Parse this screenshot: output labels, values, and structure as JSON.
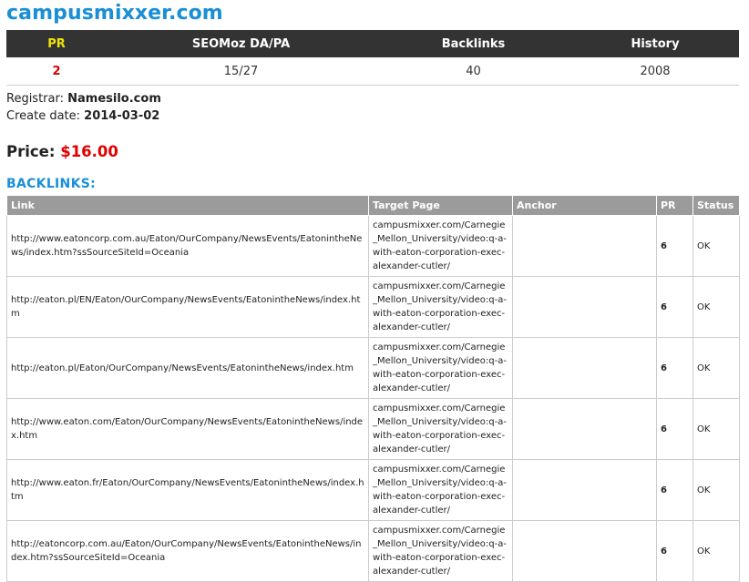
{
  "site": {
    "title": "campusmixxer.com"
  },
  "stats": {
    "headers": [
      "PR",
      "SEOMoz DA/PA",
      "Backlinks",
      "History"
    ],
    "values": [
      "2",
      "15/27",
      "40",
      "2008"
    ]
  },
  "info": {
    "registrar_label": "Registrar:",
    "registrar": "Namesilo.com",
    "create_label": "Create date:",
    "create_date": "2014-03-02"
  },
  "price": {
    "label": "Price:",
    "amount": "$16.00"
  },
  "backlinks": {
    "heading": "BACKLINKS:",
    "columns": [
      "Link",
      "Target Page",
      "Anchor",
      "PR",
      "Status"
    ],
    "rows": [
      {
        "link": "http://www.eatoncorp.com.au/Eaton/OurCompany/NewsEvents/EatonintheNews/index.htm?ssSourceSiteId=Oceania",
        "target": "campusmixxer.com/Carnegie_Mellon_University/video:q-a-with-eaton-corporation-exec-alexander-cutler/",
        "anchor": "",
        "pr": "6",
        "status": "OK"
      },
      {
        "link": "http://eaton.pl/EN/Eaton/OurCompany/NewsEvents/EatonintheNews/index.htm",
        "target": "campusmixxer.com/Carnegie_Mellon_University/video:q-a-with-eaton-corporation-exec-alexander-cutler/",
        "anchor": "",
        "pr": "6",
        "status": "OK"
      },
      {
        "link": "http://eaton.pl/Eaton/OurCompany/NewsEvents/EatonintheNews/index.htm",
        "target": "campusmixxer.com/Carnegie_Mellon_University/video:q-a-with-eaton-corporation-exec-alexander-cutler/",
        "anchor": "",
        "pr": "6",
        "status": "OK"
      },
      {
        "link": "http://www.eaton.com/Eaton/OurCompany/NewsEvents/EatonintheNews/index.htm",
        "target": "campusmixxer.com/Carnegie_Mellon_University/video:q-a-with-eaton-corporation-exec-alexander-cutler/",
        "anchor": "",
        "pr": "6",
        "status": "OK"
      },
      {
        "link": "http://www.eaton.fr/Eaton/OurCompany/NewsEvents/EatonintheNews/index.htm",
        "target": "campusmixxer.com/Carnegie_Mellon_University/video:q-a-with-eaton-corporation-exec-alexander-cutler/",
        "anchor": "",
        "pr": "6",
        "status": "OK"
      },
      {
        "link": "http://eatoncorp.com.au/Eaton/OurCompany/NewsEvents/EatonintheNews/index.htm?ssSourceSiteId=Oceania",
        "target": "campusmixxer.com/Carnegie_Mellon_University/video:q-a-with-eaton-corporation-exec-alexander-cutler/",
        "anchor": "",
        "pr": "6",
        "status": "OK"
      }
    ]
  },
  "colors": {
    "title": "#1a8fd6",
    "stats_header_bg": "#333333",
    "pr_header": "#f0e60a",
    "pr_value": "#d40000",
    "price": "#e00000",
    "table_header_bg": "#9b9b9b"
  }
}
